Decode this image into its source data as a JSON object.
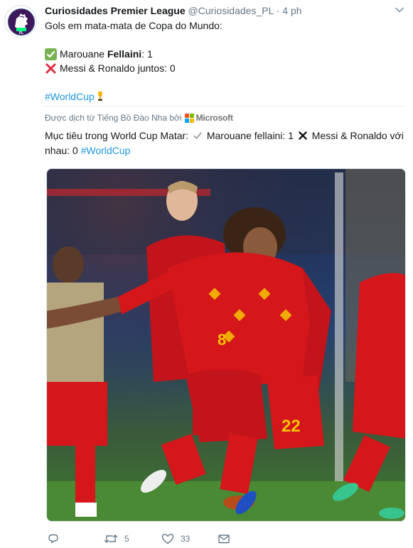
{
  "account": {
    "display_name": "Curiosidades Premier League",
    "handle": "@Curiosidades_PL",
    "separator": "·",
    "time": "4 ph",
    "avatar_icon": "premier-league-lion-logo"
  },
  "tweet": {
    "line1": "Gols em mata-mata de Copa do Mundo:",
    "line2_prefix": "Marouane ",
    "line2_bold": "Fellaini",
    "line2_suffix": ": 1",
    "line3": "Messi & Ronaldo juntos: 0",
    "hashtag": "#WorldCup",
    "check_icon": "check-mark-button-emoji",
    "cross_icon": "cross-mark-emoji",
    "trophy_icon": "trophy-emoji"
  },
  "translation": {
    "label": "Được dịch từ Tiếng Bồ Đào Nha bởi",
    "provider": "Microsoft",
    "text_part1": "Mục tiêu trong World Cup Matar:",
    "text_part2": "Marouane fellaini: 1",
    "text_part3": "Messi & Ronaldo với nhau: 0",
    "hashtag": "#WorldCup"
  },
  "media": {
    "description_icon": "photo",
    "colors": {
      "jersey_red": "#d5161b",
      "pitch_green": "#3f7a2f",
      "stand_blue": "#2c4a8a"
    }
  },
  "actions": {
    "reply_count": "",
    "retweet_count": "5",
    "like_count": "33"
  },
  "colors": {
    "text": "#14171a",
    "secondary": "#657786",
    "link": "#1b95e0",
    "divider": "#e6ecf0"
  }
}
